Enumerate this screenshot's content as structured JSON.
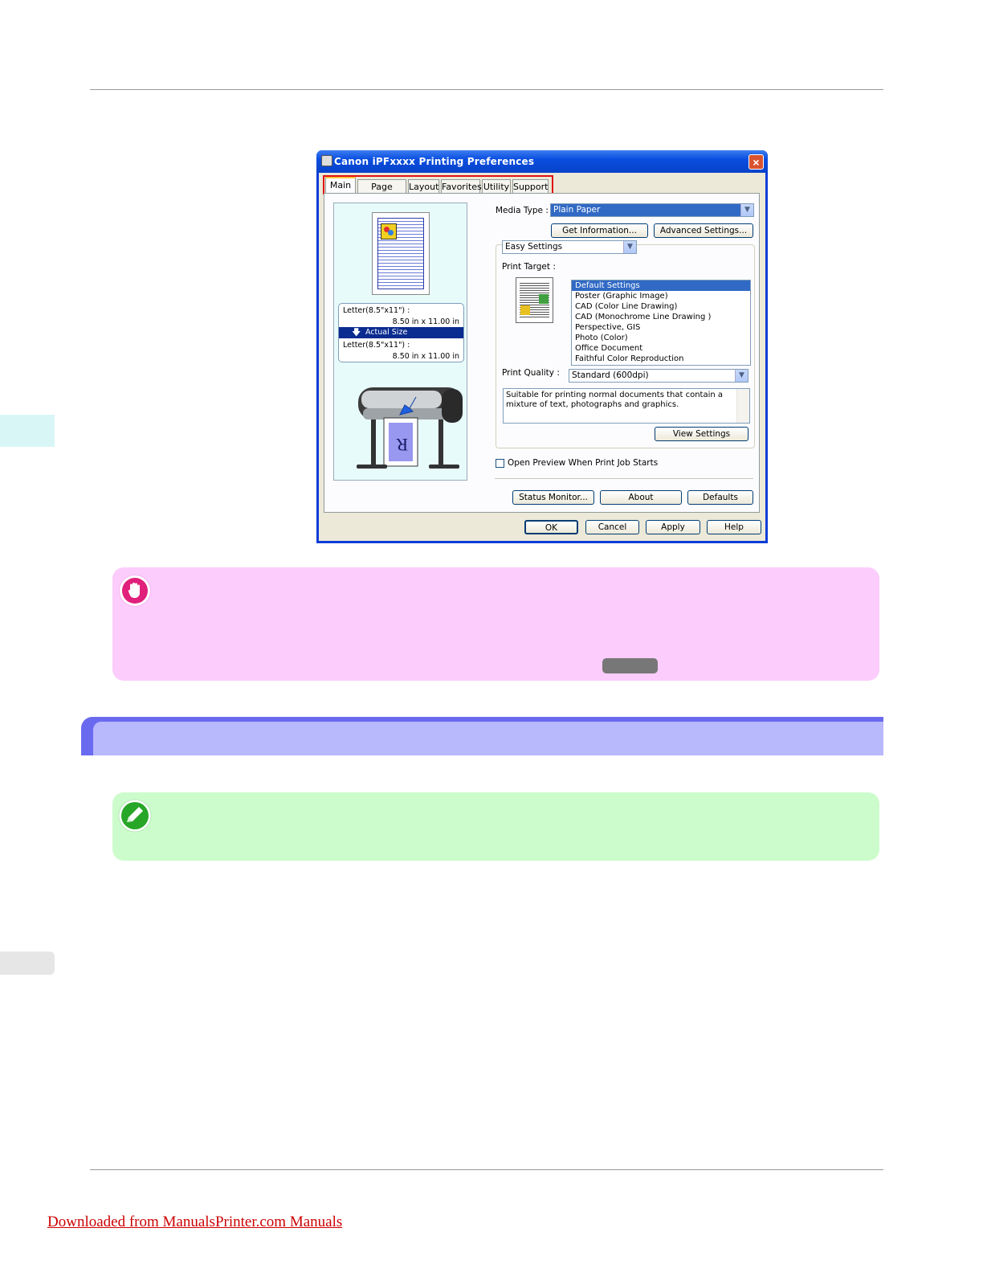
{
  "dialog": {
    "title": "Canon iPFxxxx Printing Preferences",
    "close_label": "×",
    "tabs": [
      "Main",
      "Page Setup",
      "Layout",
      "Favorites",
      "Utility",
      "Support"
    ],
    "preview": {
      "original_size": "Letter(8.5\"x11\") :",
      "original_dims": "8.50 in x 11.00 in",
      "scale": "Actual Size",
      "output_size": "Letter(8.5\"x11\") :",
      "output_dims": "8.50 in x 11.00 in",
      "printer_letter": "R"
    },
    "media_type_label": "Media Type :",
    "media_type_value": "Plain Paper",
    "get_information_label": "Get Information...",
    "advanced_settings_label": "Advanced Settings...",
    "mode_value": "Easy Settings",
    "print_target_label": "Print Target :",
    "print_targets": [
      "Default Settings",
      "Poster (Graphic Image)",
      "CAD (Color Line Drawing)",
      "CAD (Monochrome Line Drawing )",
      "Perspective, GIS",
      "Photo (Color)",
      "Office Document",
      "Faithful Color Reproduction"
    ],
    "print_quality_label": "Print Quality :",
    "print_quality_value": "Standard (600dpi)",
    "description": "Suitable for printing normal documents that contain a mixture of text, photographs and graphics.",
    "view_settings_label": "View Settings",
    "open_preview_label": "Open Preview When Print Job Starts",
    "status_monitor_label": "Status Monitor...",
    "about_label": "About",
    "defaults_label": "Defaults",
    "ok_label": "OK",
    "cancel_label": "Cancel",
    "apply_label": "Apply",
    "help_label": "Help"
  },
  "footer_link": "Downloaded from ManualsPrinter.com Manuals",
  "colors": {
    "important_bg": "#fcccfc",
    "note_bg": "#ccfccc",
    "section_bar": "#b8b8fc",
    "link": "#cc0000"
  }
}
